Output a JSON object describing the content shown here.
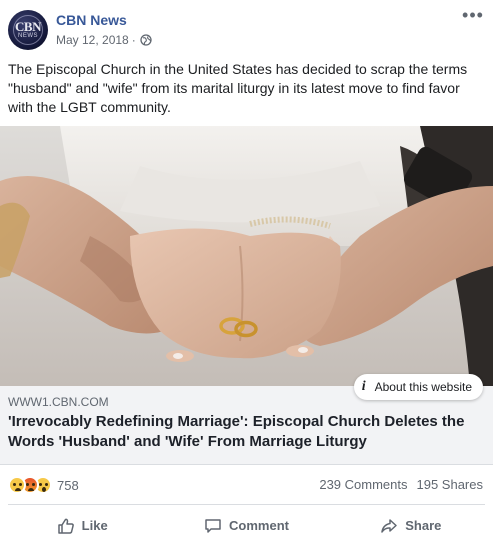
{
  "post": {
    "page_name": "CBN News",
    "date": "May 12, 2018",
    "separator": "·",
    "privacy_icon": "globe-icon",
    "more_icon": "more-dots-icon",
    "avatar": {
      "line1": "CBN",
      "line2": "NEWS"
    },
    "text": "The Episcopal Church in the United States has decided to scrap the terms \"husband\" and \"wife\" from its marital liturgy in its latest move to find favor with the LGBT community."
  },
  "link_preview": {
    "domain": "WWW1.CBN.COM",
    "headline": "'Irrevocably Redefining Marriage': Episcopal Church Deletes the Words 'Husband' and 'Wife' From Marriage Liturgy",
    "about_label": "About this website",
    "about_icon": "i"
  },
  "stats": {
    "reaction_icons": [
      "sad-reaction-icon",
      "angry-reaction-icon",
      "wow-reaction-icon"
    ],
    "reaction_count": "758",
    "comments": "239 Comments",
    "shares": "195 Shares"
  },
  "actions": {
    "like": "Like",
    "comment": "Comment",
    "share": "Share"
  },
  "colors": {
    "link_blue": "#385898",
    "meta_gray": "#606770",
    "preview_bg": "#f2f3f5"
  }
}
